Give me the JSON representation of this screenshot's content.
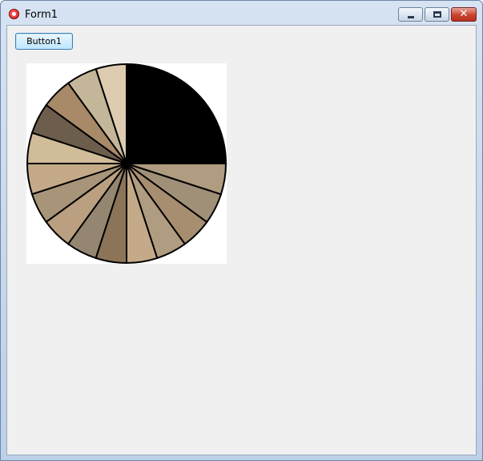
{
  "window": {
    "title": "Form1",
    "icon": "app-icon",
    "controls": {
      "minimize": "minimize-icon",
      "maximize": "maximize-icon",
      "close": "close-icon",
      "close_glyph": "✕"
    }
  },
  "button1": {
    "label": "Button1"
  },
  "chart_data": {
    "type": "pie",
    "start_angle_deg": 0,
    "direction": "counterclockwise",
    "stroke_color": "#000000",
    "slices": [
      {
        "value": 25.0,
        "color": "#000000"
      },
      {
        "value": 5.0,
        "color": "#ddccb0"
      },
      {
        "value": 5.0,
        "color": "#c4b698"
      },
      {
        "value": 5.0,
        "color": "#a88968"
      },
      {
        "value": 5.0,
        "color": "#6d5d4c"
      },
      {
        "value": 5.0,
        "color": "#d0bc98"
      },
      {
        "value": 5.0,
        "color": "#c4aa88"
      },
      {
        "value": 5.0,
        "color": "#a89478"
      },
      {
        "value": 5.0,
        "color": "#baa080"
      },
      {
        "value": 5.0,
        "color": "#948670"
      },
      {
        "value": 5.0,
        "color": "#8c7458"
      },
      {
        "value": 5.0,
        "color": "#c4aa88"
      },
      {
        "value": 5.0,
        "color": "#b09c80"
      },
      {
        "value": 5.0,
        "color": "#a88e70"
      },
      {
        "value": 5.0,
        "color": "#a09078"
      },
      {
        "value": 5.0,
        "color": "#b09c80"
      }
    ]
  }
}
